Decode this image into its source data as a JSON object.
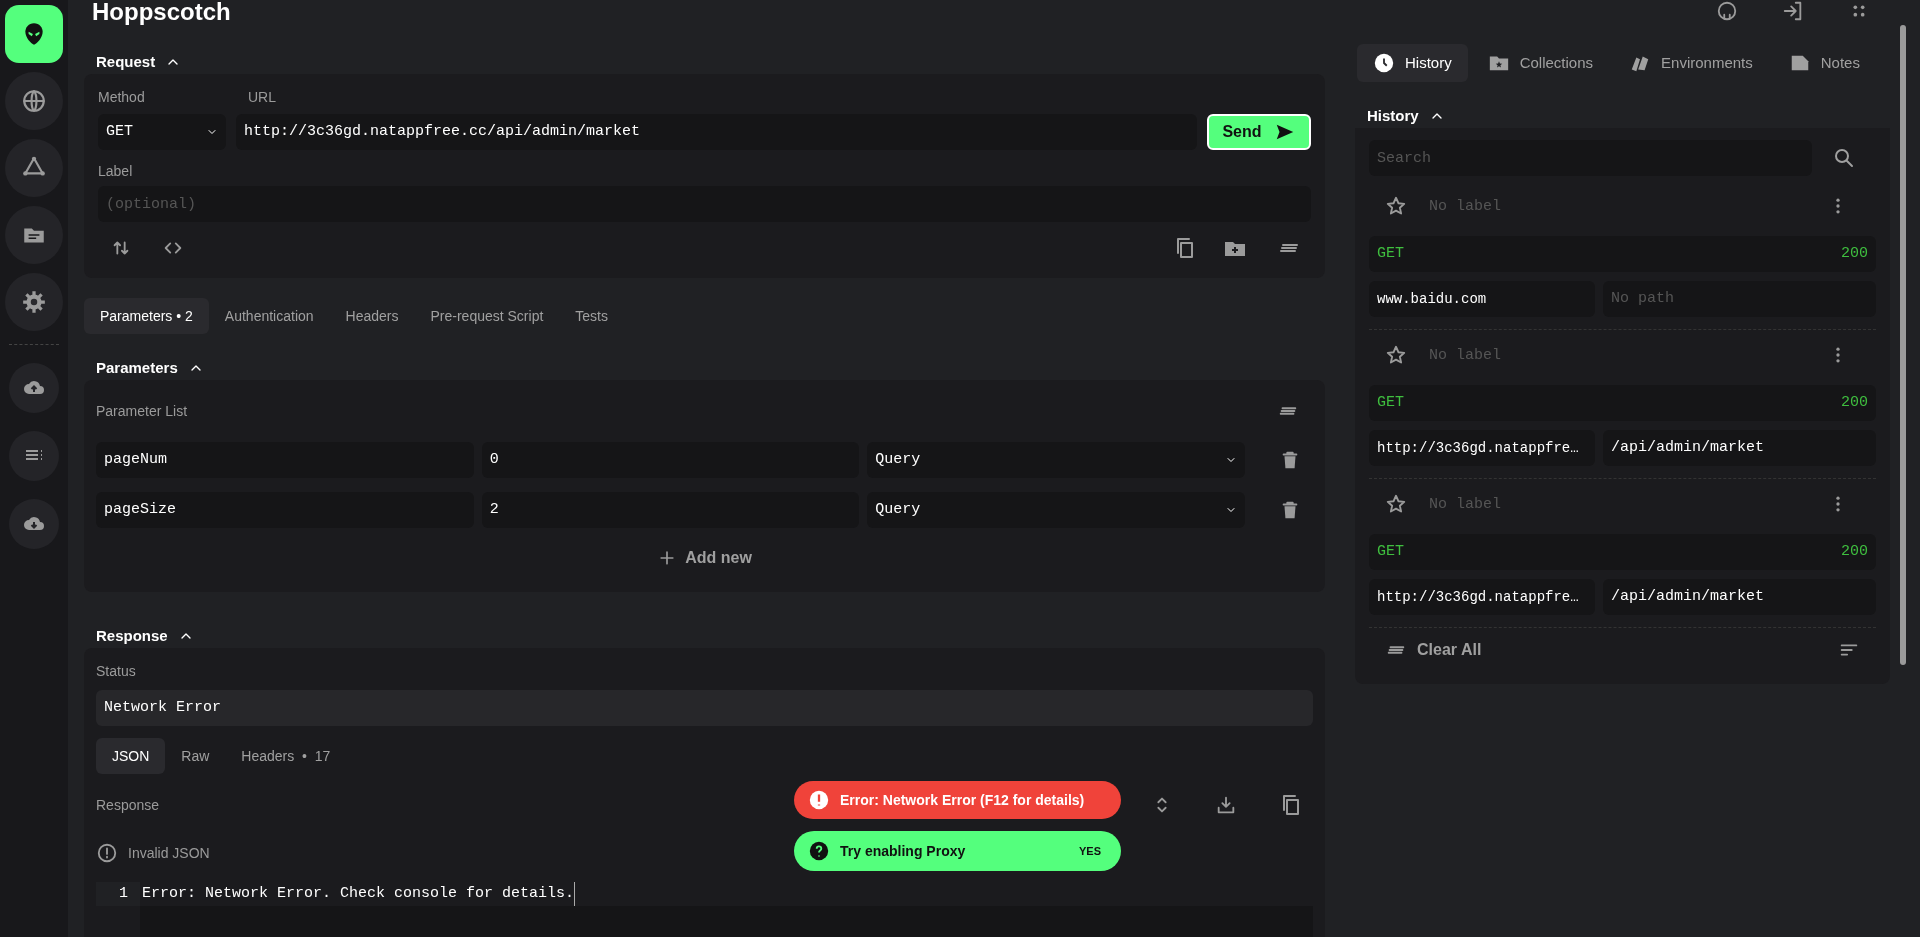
{
  "app": {
    "title": "Hoppscotch"
  },
  "sidebar": {
    "items": [
      {
        "selected": true
      },
      {
        "selected": false
      },
      {
        "selected": false
      },
      {
        "selected": false
      },
      {
        "selected": false
      }
    ]
  },
  "request": {
    "heading": "Request",
    "expanded": true,
    "method_label": "Method",
    "method": "GET",
    "url_label": "URL",
    "url": "http://3c36gd.natappfree.cc/api/admin/market",
    "send": "Send",
    "label_label": "Label",
    "label_placeholder": "(optional)"
  },
  "request_tabs": [
    {
      "label": "Parameters",
      "bullet": "•",
      "count": "2",
      "selected": true
    },
    {
      "label": "Authentication",
      "selected": false
    },
    {
      "label": "Headers",
      "selected": false
    },
    {
      "label": "Pre-request Script",
      "selected": false
    },
    {
      "label": "Tests",
      "selected": false
    }
  ],
  "parameters": {
    "heading": "Parameters",
    "expanded": true,
    "list_label": "Parameter List",
    "rows": [
      {
        "key": "pageNum",
        "value": "0",
        "type": "Query"
      },
      {
        "key": "pageSize",
        "value": "2",
        "type": "Query"
      }
    ],
    "add": "Add new"
  },
  "response": {
    "heading": "Response",
    "expanded": true,
    "status_label": "Status",
    "status": "Network Error",
    "tabs": [
      {
        "label": "JSON",
        "selected": true
      },
      {
        "label": "Raw",
        "selected": false
      },
      {
        "label": "Headers",
        "bullet": "•",
        "count": "17",
        "selected": false
      }
    ],
    "body_label": "Response",
    "notice": "Invalid JSON",
    "lines": [
      {
        "number": "1",
        "text": "Error: Network Error. Check console for details."
      }
    ]
  },
  "toasts": [
    {
      "kind": "error",
      "text": "Error: Network Error (F12 for details)"
    },
    {
      "kind": "action",
      "text": "Try enabling Proxy",
      "action": "YES"
    }
  ],
  "side_tabs": [
    {
      "label": "History",
      "selected": true
    },
    {
      "label": "Collections",
      "selected": false
    },
    {
      "label": "Environments",
      "selected": false
    },
    {
      "label": "Notes",
      "selected": false
    }
  ],
  "history": {
    "heading": "History",
    "expanded": true,
    "search_placeholder": "Search",
    "entries": [
      {
        "starred": false,
        "label_placeholder": "No label",
        "method": "GET",
        "status": "200",
        "host": "www.baidu.com",
        "path_placeholder": "No path"
      },
      {
        "starred": false,
        "label_placeholder": "No label",
        "method": "GET",
        "status": "200",
        "host": "http://3c36gd.natappfre…",
        "path": "/api/admin/market"
      },
      {
        "starred": false,
        "label_placeholder": "No label",
        "method": "GET",
        "status": "200",
        "host": "http://3c36gd.natappfre…",
        "path": "/api/admin/market"
      }
    ],
    "clear": "Clear All"
  }
}
